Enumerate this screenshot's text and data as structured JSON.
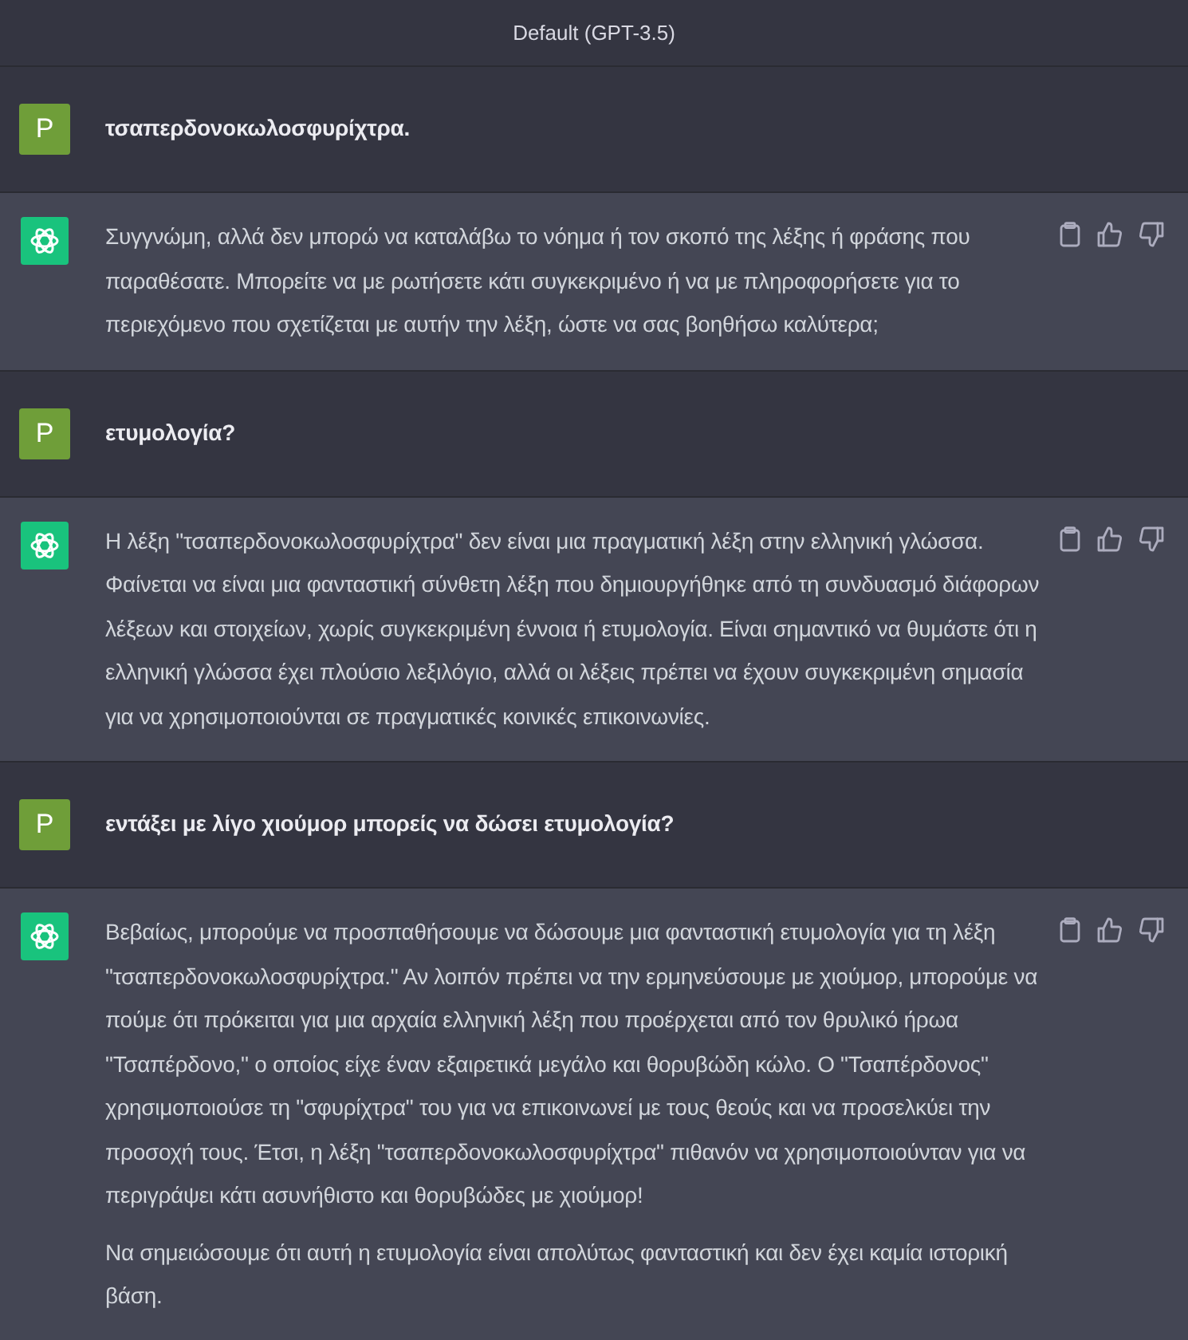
{
  "header": {
    "title": "Default (GPT-3.5)"
  },
  "messages": [
    {
      "kind": "user",
      "avatar": "P",
      "paragraphs": [
        "τσαπερδονοκωλοσφυρίχτρα."
      ]
    },
    {
      "kind": "assistant",
      "paragraphs": [
        "Συγγνώμη, αλλά δεν μπορώ να καταλάβω το νόημα ή τον σκοπό της λέξης ή φράσης που παραθέσατε. Μπορείτε να με ρωτήσετε κάτι συγκεκριμένο ή να με πληροφορήσετε για το περιεχόμενο που σχετίζεται με αυτήν την λέξη, ώστε να σας βοηθήσω καλύτερα;"
      ]
    },
    {
      "kind": "user",
      "avatar": "P",
      "paragraphs": [
        "ετυμολογία?"
      ]
    },
    {
      "kind": "assistant",
      "paragraphs": [
        "Η λέξη \"τσαπερδονοκωλοσφυρίχτρα\" δεν είναι μια πραγματική λέξη στην ελληνική γλώσσα. Φαίνεται να είναι μια φανταστική σύνθετη λέξη που δημιουργήθηκε από τη συνδυασμό διάφορων λέξεων και στοιχείων, χωρίς συγκεκριμένη έννοια ή ετυμολογία. Είναι σημαντικό να θυμάστε ότι η ελληνική γλώσσα έχει πλούσιο λεξιλόγιο, αλλά οι λέξεις πρέπει να έχουν συγκεκριμένη σημασία για να χρησιμοποιούνται σε πραγματικές κοινικές επικοινωνίες."
      ]
    },
    {
      "kind": "user",
      "avatar": "P",
      "paragraphs": [
        "εντάξει με λίγο χιούμορ μπορείς να δώσει ετυμολογία?"
      ]
    },
    {
      "kind": "assistant",
      "paragraphs": [
        "Βεβαίως, μπορούμε να προσπαθήσουμε να δώσουμε μια φανταστική ετυμολογία για τη λέξη \"τσαπερδονοκωλοσφυρίχτρα.\" Αν λοιπόν πρέπει να την ερμηνεύσουμε με χιούμορ, μπορούμε να πούμε ότι πρόκειται για μια αρχαία ελληνική λέξη που προέρχεται από τον θρυλικό ήρωα \"Τσαπέρδονο,\" ο οποίος είχε έναν εξαιρετικά μεγάλο και θορυβώδη κώλο. Ο \"Τσαπέρδονος\" χρησιμοποιούσε τη \"σφυρίχτρα\" του για να επικοινωνεί με τους θεούς και να προσελκύει την προσοχή τους. Έτσι, η λέξη \"τσαπερδονοκωλοσφυρίχτρα\" πιθανόν να χρησιμοποιούνταν για να περιγράψει κάτι ασυνήθιστο και θορυβώδες με χιούμορ!",
        "Να σημειώσουμε ότι αυτή η ετυμολογία είναι απολύτως φανταστική και δεν έχει καμία ιστορική βάση."
      ]
    }
  ]
}
